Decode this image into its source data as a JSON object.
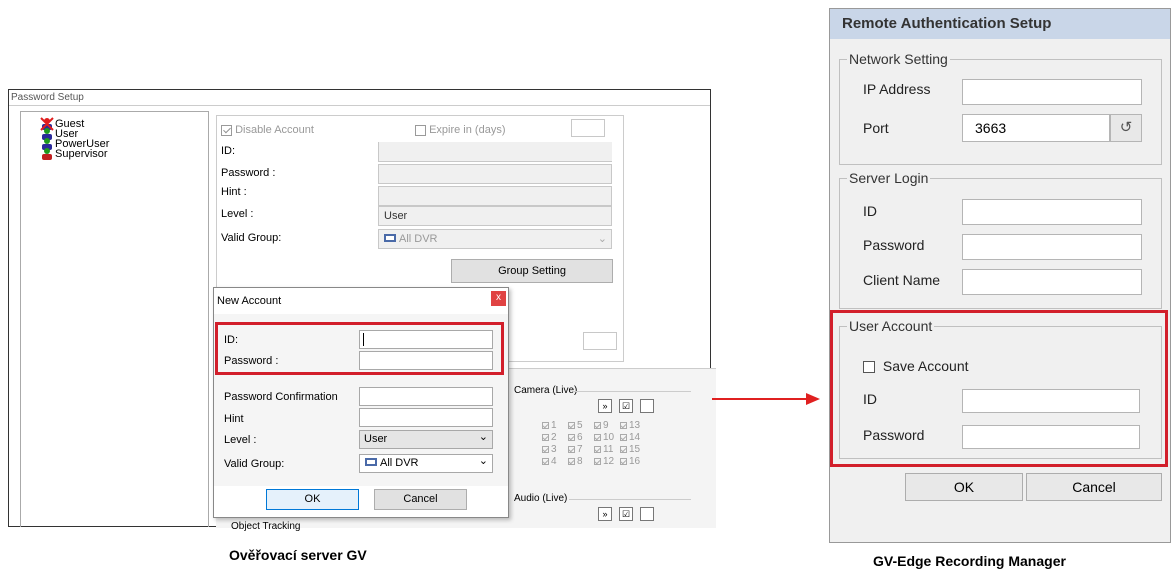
{
  "left": {
    "window_title": "Password Setup",
    "tree": [
      "Guest",
      "User",
      "PowerUser",
      "Supervisor"
    ],
    "disable_account": "Disable Account",
    "expire": "Expire in (days)",
    "fields": [
      "ID:",
      "Password :",
      "Hint :",
      "Level :",
      "Valid Group:"
    ],
    "level_value": "User",
    "valid_group_value": "All DVR",
    "group_setting": "Group Setting",
    "camera_live": "Camera (Live)",
    "audio_live": "Audio (Live)",
    "object_tracking": "Object Tracking",
    "camera_numbers": [
      [
        "1",
        "5",
        "9",
        "13"
      ],
      [
        "2",
        "6",
        "10",
        "14"
      ],
      [
        "3",
        "7",
        "11",
        "15"
      ],
      [
        "4",
        "8",
        "12",
        "16"
      ]
    ],
    "dialog": {
      "title": "New Account",
      "close": "x",
      "labels": [
        "ID:",
        "Password :",
        "Password Confirmation",
        "Hint",
        "Level :",
        "Valid Group:"
      ],
      "level_value": "User",
      "group_value": "All DVR",
      "ok": "OK",
      "cancel": "Cancel"
    },
    "caption": "Ověřovací server GV"
  },
  "right": {
    "title": "Remote Authentication Setup",
    "network_setting": "Network Setting",
    "ip_label": "IP Address",
    "ip_value": "",
    "port_label": "Port",
    "port_value": "3663",
    "server_login": "Server Login",
    "id_label": "ID",
    "password_label": "Password",
    "client_name_label": "Client Name",
    "user_account": "User Account",
    "save_account": "Save Account",
    "ua_id_label": "ID",
    "ua_password_label": "Password",
    "ok": "OK",
    "cancel": "Cancel",
    "caption": "GV-Edge Recording Manager"
  },
  "colors": {
    "highlight": "#d21f2b",
    "arrow": "#e02020"
  }
}
